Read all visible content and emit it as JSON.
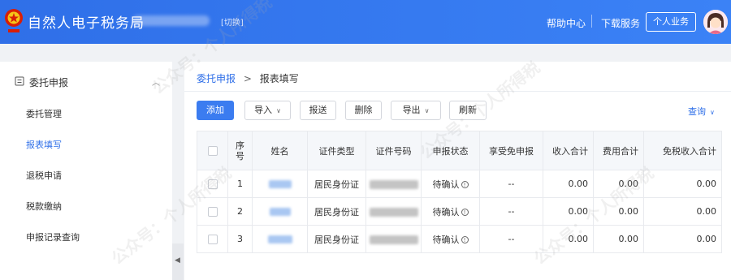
{
  "header": {
    "title": "自然人电子税务局",
    "switch_label": "[切换]",
    "help_label": "帮助中心",
    "download_label": "下载服务",
    "personal_label": "个人业务",
    "brand_color": "#3b7cf0"
  },
  "sidebar": {
    "group_label": "委托申报",
    "group_icon": "document-icon",
    "items": [
      {
        "label": "委托管理",
        "active": false
      },
      {
        "label": "报表填写",
        "active": true
      },
      {
        "label": "退税申请",
        "active": false
      },
      {
        "label": "税款缴纳",
        "active": false
      },
      {
        "label": "申报记录查询",
        "active": false
      }
    ]
  },
  "breadcrumb": {
    "parent": "委托申报",
    "separator": ">",
    "current": "报表填写"
  },
  "toolbar": {
    "add_label": "添加",
    "import_label": "导入",
    "submit_label": "报送",
    "delete_label": "删除",
    "export_label": "导出",
    "refresh_label": "刷新",
    "query_label": "查询"
  },
  "table": {
    "headers": {
      "seq": "序号",
      "name": "姓名",
      "id_type": "证件类型",
      "id_no": "证件号码",
      "status": "申报状态",
      "exempt": "享受免申报",
      "income": "收入合计",
      "expense": "费用合计",
      "taxfree": "免税收入合计"
    },
    "rows": [
      {
        "seq": "1",
        "id_type": "居民身份证",
        "status": "待确认",
        "exempt": "--",
        "income": "0.00",
        "expense": "0.00",
        "taxfree": "0.00"
      },
      {
        "seq": "2",
        "id_type": "居民身份证",
        "status": "待确认",
        "exempt": "--",
        "income": "0.00",
        "expense": "0.00",
        "taxfree": "0.00"
      },
      {
        "seq": "3",
        "id_type": "居民身份证",
        "status": "待确认",
        "exempt": "--",
        "income": "0.00",
        "expense": "0.00",
        "taxfree": "0.00"
      }
    ]
  },
  "watermark": "公众号：个人所得税"
}
